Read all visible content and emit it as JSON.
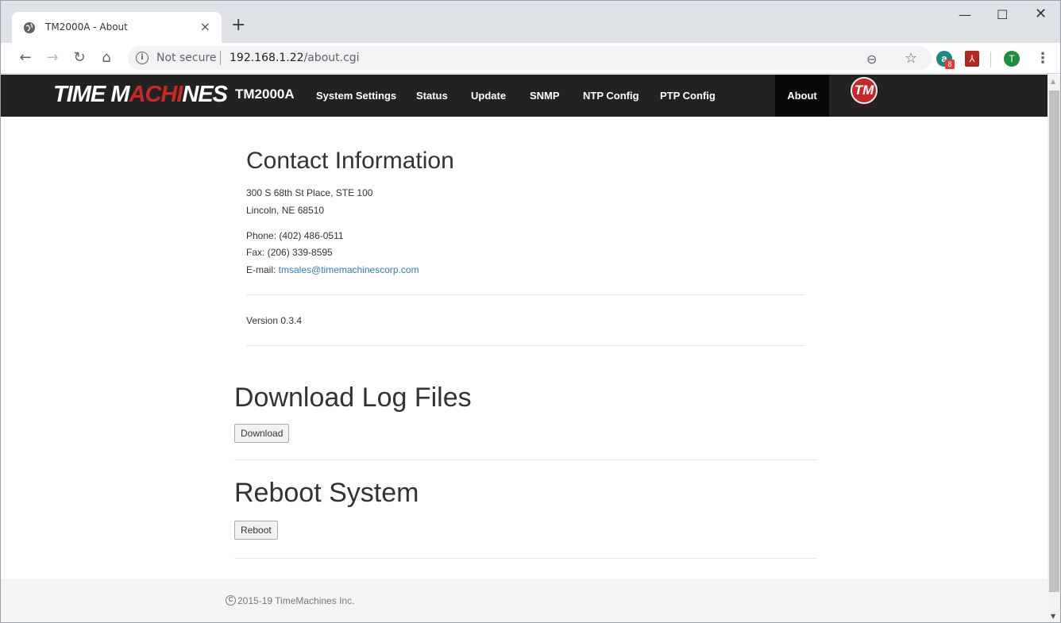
{
  "browser": {
    "tab_title": "TM2000A - About",
    "tab_close": "×",
    "new_tab": "+",
    "win_min": "—",
    "win_max": "☐",
    "win_close": "✕",
    "security_label": "Not secure",
    "url_host": "192.168.1.22",
    "url_path": "/about.cgi",
    "ext_badge_count": "8",
    "avatar_letter": "T"
  },
  "navbar": {
    "logo_left": "TIME M",
    "logo_seg": "ACHI",
    "logo_right": "NES",
    "brand": "TM2000A",
    "items": [
      {
        "label": "System Settings"
      },
      {
        "label": "Status"
      },
      {
        "label": "Update"
      },
      {
        "label": "SNMP"
      },
      {
        "label": "NTP Config"
      },
      {
        "label": "PTP Config"
      },
      {
        "label": "About"
      }
    ],
    "active_item": "About",
    "badge_text": "TM"
  },
  "contact": {
    "heading": "Contact Information",
    "address_line1": "300 S 68th St Place, STE 100",
    "address_line2": "Lincoln, NE 68510",
    "phone": "Phone: (402) 486-0511",
    "fax": "Fax: (206) 339-8595",
    "email_label": "E-mail: ",
    "email": "tmsales@timemachinescorp.com"
  },
  "version": "Version 0.3.4",
  "download": {
    "heading": "Download Log Files",
    "button": "Download"
  },
  "reboot": {
    "heading": "Reboot System",
    "button": "Reboot"
  },
  "footer": {
    "copyright": "2015-19 TimeMachines Inc."
  },
  "colors": {
    "navbar_bg": "#222222",
    "link": "#337ab7",
    "accent_red": "#c62828"
  }
}
